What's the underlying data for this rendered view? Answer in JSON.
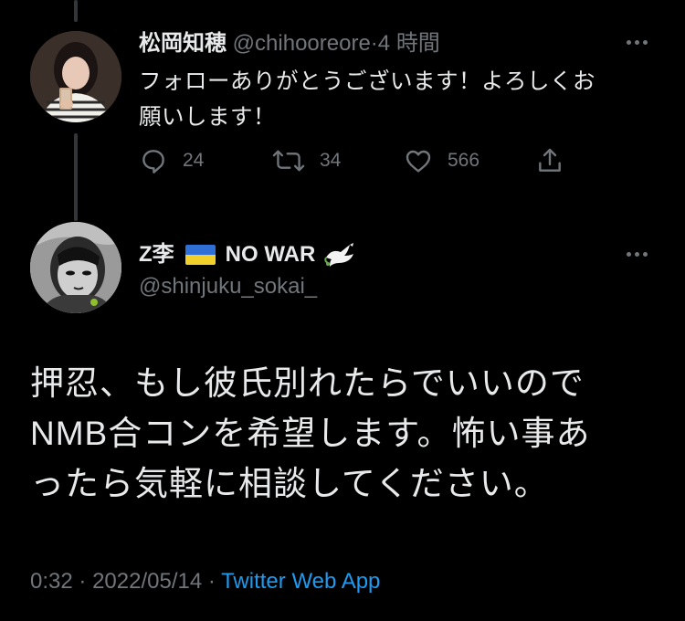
{
  "reply": {
    "display_name": "松岡知穂",
    "handle": "@chihooreore",
    "separator": "·",
    "time_ago": "4 時間",
    "text_line1": "フォローありがとうございます！よろしくお",
    "text_line2": "願いします！",
    "actions": {
      "reply_count": "24",
      "retweet_count": "34",
      "like_count": "566"
    },
    "icons": {
      "reply": "reply-icon",
      "retweet": "retweet-icon",
      "like": "heart-icon",
      "share": "share-icon",
      "more": "more-icon"
    }
  },
  "main_tweet": {
    "display_name_prefix": "Z李",
    "display_name_suffix": "NO WAR",
    "flag": "ukraine-flag",
    "dove": "dove-icon",
    "handle": "@shinjuku_sokai_",
    "text_line1": "押忍、もし彼氏別れたらでいいので",
    "text_line2": "NMB合コンを希望します。怖い事あ",
    "text_line3": "ったら気軽に相談してください。",
    "timestamp_time": "0:32",
    "separator1": "·",
    "timestamp_date": "2022/05/14",
    "separator2": "·",
    "source_app": "Twitter Web App"
  },
  "colors": {
    "background": "#000000",
    "text": "#e7e9ea",
    "secondary": "#71767b",
    "link": "#1d9bf0",
    "thread_line": "#333639"
  }
}
